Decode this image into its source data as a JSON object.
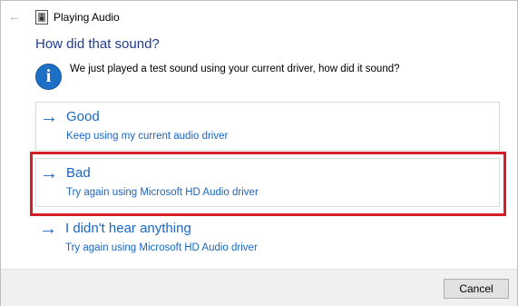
{
  "window": {
    "title": "Playing Audio",
    "back_icon": "back-arrow-icon",
    "app_icon": "speaker-document-icon"
  },
  "main": {
    "heading": "How did that sound?",
    "info": {
      "icon": "info-icon",
      "glyph": "i",
      "text": "We just played a test sound using your current driver, how did it sound?"
    },
    "options": [
      {
        "arrow": "→",
        "title": "Good",
        "subtitle": "Keep using my current audio driver"
      },
      {
        "arrow": "→",
        "title": "Bad",
        "subtitle": "Try again using Microsoft HD Audio driver"
      },
      {
        "arrow": "→",
        "title": "I didn't hear anything",
        "subtitle": "Try again using Microsoft HD Audio driver"
      }
    ]
  },
  "footer": {
    "cancel_label": "Cancel"
  },
  "colors": {
    "link_blue": "#1a66c2",
    "heading_blue": "#1d3a8f",
    "highlight_red": "#d41f26",
    "footer_bg": "#f0f0f0"
  }
}
